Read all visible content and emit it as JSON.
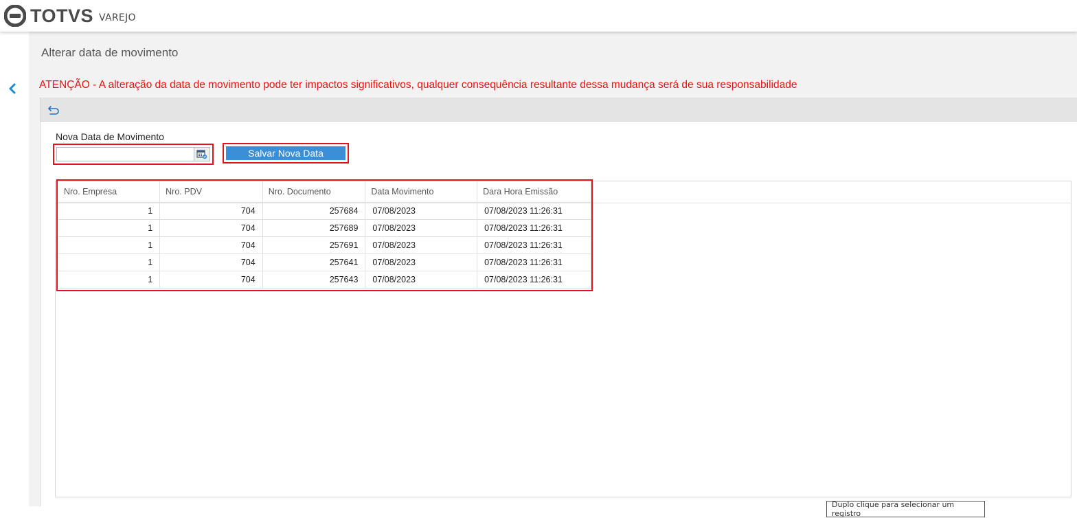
{
  "header": {
    "brand": "TOTVS",
    "product": "VAREJO"
  },
  "page": {
    "title": "Alterar data de movimento",
    "warning": "ATENÇÃO - A alteração da data de movimento pode ter impactos significativos, qualquer consequência resultante dessa mudança será de sua responsabilidade"
  },
  "form": {
    "date_label": "Nova Data de Movimento",
    "date_value": "",
    "date_placeholder": "",
    "save_label": "Salvar Nova Data"
  },
  "table": {
    "columns": [
      "Nro. Empresa",
      "Nro. PDV",
      "Nro. Documento",
      "Data Movimento",
      "Dara Hora Emissão"
    ],
    "rows": [
      [
        "1",
        "704",
        "257684",
        "07/08/2023",
        "07/08/2023 11:26:31"
      ],
      [
        "1",
        "704",
        "257689",
        "07/08/2023",
        "07/08/2023 11:26:31"
      ],
      [
        "1",
        "704",
        "257691",
        "07/08/2023",
        "07/08/2023 11:26:31"
      ],
      [
        "1",
        "704",
        "257641",
        "07/08/2023",
        "07/08/2023 11:26:31"
      ],
      [
        "1",
        "704",
        "257643",
        "07/08/2023",
        "07/08/2023 11:26:31"
      ]
    ]
  },
  "tooltip": "Duplo clique para selecionar um registro",
  "icons": {
    "logo": "totvs-logo-icon",
    "back": "chevron-left-icon",
    "undo": "undo-icon",
    "calendar": "calendar-icon"
  },
  "colors": {
    "accent": "#3a8fd6",
    "warning": "#ee1111",
    "highlight": "#e0151c",
    "back_chevron": "#1a8ad4"
  }
}
